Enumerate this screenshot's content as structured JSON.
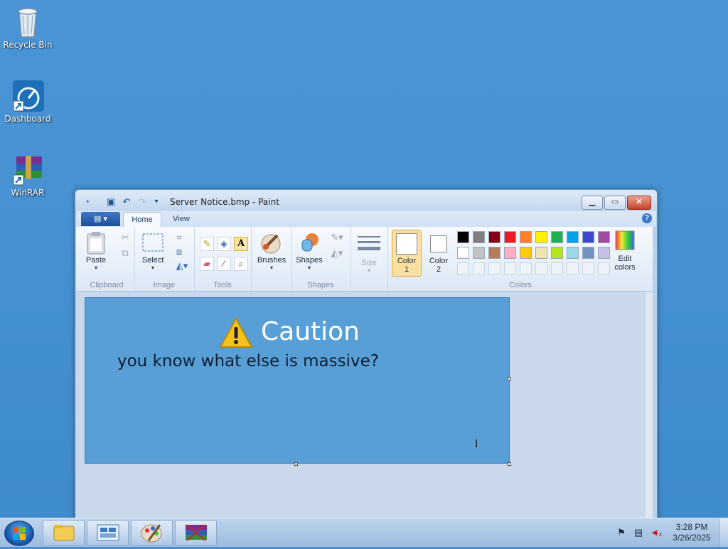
{
  "desktop": {
    "icons": [
      {
        "label": "Recycle Bin"
      },
      {
        "label": "Dashboard"
      },
      {
        "label": "WinRAR"
      }
    ]
  },
  "window": {
    "title": "Server Notice.bmp - Paint",
    "tabs": [
      "Home",
      "View"
    ],
    "active_tab": "Home",
    "app_menu_icon": "menu-icon"
  },
  "ribbon": {
    "clipboard": {
      "paste": "Paste",
      "label": "Clipboard"
    },
    "image": {
      "select": "Select",
      "label": "Image"
    },
    "tools": {
      "label": "Tools"
    },
    "brushes": {
      "label": "Brushes"
    },
    "shapes": {
      "button": "Shapes",
      "label": "Shapes"
    },
    "size": {
      "label": "Size"
    },
    "colors": {
      "color1": "Color\n1",
      "color1_l1": "Color",
      "color1_l2": "1",
      "color2_l1": "Color",
      "color2_l2": "2",
      "edit_l1": "Edit",
      "edit_l2": "colors",
      "label": "Colors",
      "palette_row1": [
        "#000000",
        "#7f7f7f",
        "#880015",
        "#ed1c24",
        "#ff7f27",
        "#fff200",
        "#22b14c",
        "#00a2e8",
        "#3f48cc",
        "#a349a4"
      ],
      "palette_row2": [
        "#ffffff",
        "#c3c3c3",
        "#b97a57",
        "#ffaec9",
        "#ffc90e",
        "#efe4b0",
        "#b5e61d",
        "#99d9ea",
        "#7092be",
        "#c8bfe7"
      ],
      "color1_value": "#ffffff",
      "color2_value": "#ffffff"
    }
  },
  "canvas": {
    "heading": "Caution",
    "message": "you know what else is massive?",
    "background": "#579fd6"
  },
  "taskbar": {
    "items": [
      "file-explorer-icon",
      "dashboard-icon",
      "paint-icon",
      "winrar-icon"
    ],
    "time": "3:28 PM",
    "date": "3/26/2025"
  }
}
